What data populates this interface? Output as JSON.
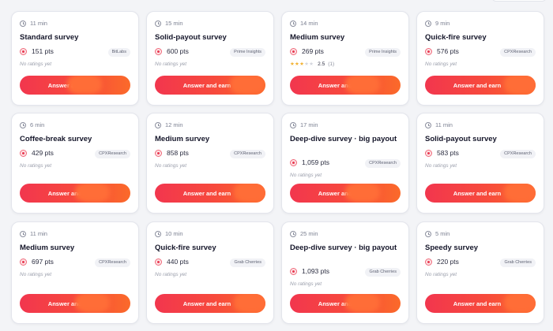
{
  "surveys": [
    {
      "time": "11 min",
      "title": "Standard survey",
      "points": "151 pts",
      "provider": "BitLabs",
      "ratings_note": "No ratings yet",
      "rating": null,
      "cta": "Answer and earn"
    },
    {
      "time": "15 min",
      "title": "Solid-payout survey",
      "points": "600 pts",
      "provider": "Prime Insights",
      "ratings_note": "No ratings yet",
      "rating": null,
      "cta": "Answer and earn"
    },
    {
      "time": "14 min",
      "title": "Medium survey",
      "points": "269 pts",
      "provider": "Prime Insights",
      "ratings_note": "",
      "rating": {
        "value": "2.5",
        "count": "(1)",
        "stars_filled": 2.5
      },
      "cta": "Answer and earn"
    },
    {
      "time": "9 min",
      "title": "Quick-fire survey",
      "points": "576 pts",
      "provider": "CPXResearch",
      "ratings_note": "No ratings yet",
      "rating": null,
      "cta": "Answer and earn"
    },
    {
      "time": "6 min",
      "title": "Coffee-break survey",
      "points": "429 pts",
      "provider": "CPXResearch",
      "ratings_note": "No ratings yet",
      "rating": null,
      "cta": "Answer and earn"
    },
    {
      "time": "12 min",
      "title": "Medium survey",
      "points": "858 pts",
      "provider": "CPXResearch",
      "ratings_note": "No ratings yet",
      "rating": null,
      "cta": "Answer and earn"
    },
    {
      "time": "17 min",
      "title": "Deep-dive survey · big payout",
      "points": "1,059 pts",
      "provider": "CPXResearch",
      "ratings_note": "No ratings yet",
      "rating": null,
      "cta": "Answer and earn"
    },
    {
      "time": "11 min",
      "title": "Solid-payout survey",
      "points": "583 pts",
      "provider": "CPXResearch",
      "ratings_note": "No ratings yet",
      "rating": null,
      "cta": "Answer and earn"
    },
    {
      "time": "11 min",
      "title": "Medium survey",
      "points": "697 pts",
      "provider": "CPXResearch",
      "ratings_note": "No ratings yet",
      "rating": null,
      "cta": "Answer and earn"
    },
    {
      "time": "10 min",
      "title": "Quick-fire survey",
      "points": "440 pts",
      "provider": "Grab Cherries",
      "ratings_note": "No ratings yet",
      "rating": null,
      "cta": "Answer and earn"
    },
    {
      "time": "25 min",
      "title": "Deep-dive survey · big payout",
      "points": "1,093 pts",
      "provider": "Grab Cherries",
      "ratings_note": "No ratings yet",
      "rating": null,
      "cta": "Answer and earn"
    },
    {
      "time": "5 min",
      "title": "Speedy survey",
      "points": "220 pts",
      "provider": "Grab Cherries",
      "ratings_note": "No ratings yet",
      "rating": null,
      "cta": "Answer and earn"
    }
  ],
  "icons": {
    "time": "clock-icon",
    "points": "coin-icon",
    "rating": "star-icon"
  },
  "colors": {
    "cta_start": "#f2364e",
    "cta_end": "#fb6a2a",
    "star": "#f2b233",
    "coin": "#e8384f"
  }
}
